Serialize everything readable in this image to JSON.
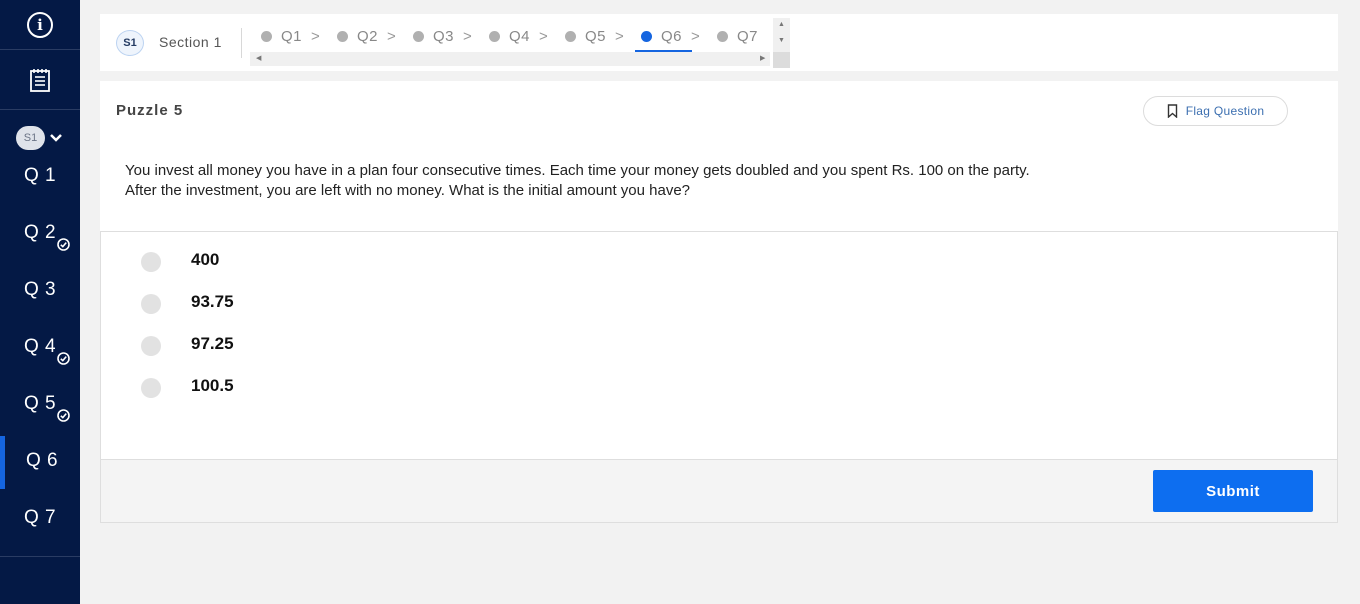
{
  "sidebar": {
    "section_badge": "S1",
    "questions": [
      {
        "label": "Q 1",
        "answered": false,
        "active": false
      },
      {
        "label": "Q 2",
        "answered": true,
        "active": false
      },
      {
        "label": "Q 3",
        "answered": false,
        "active": false
      },
      {
        "label": "Q 4",
        "answered": true,
        "active": false
      },
      {
        "label": "Q 5",
        "answered": true,
        "active": false
      },
      {
        "label": "Q 6",
        "answered": false,
        "active": true
      },
      {
        "label": "Q 7",
        "answered": false,
        "active": false
      }
    ]
  },
  "topnav": {
    "section_badge": "S1",
    "section_label": "Section 1",
    "tabs": [
      "Q1",
      "Q2",
      "Q3",
      "Q4",
      "Q5",
      "Q6",
      "Q7"
    ],
    "active_tab": "Q6"
  },
  "question": {
    "title": "Puzzle 5",
    "flag_label": "Flag Question",
    "text_line1": "You invest all money you have in a plan four consecutive times. Each time your money gets doubled and you spent Rs. 100 on the party.",
    "text_line2": "After the investment, you are left with no money. What is the initial amount you have?"
  },
  "options": [
    "400",
    "93.75",
    "97.25",
    "100.5"
  ],
  "footer": {
    "submit_label": "Submit"
  },
  "colors": {
    "sidebar_bg": "#041945",
    "accent": "#1565e0",
    "submit_bg": "#0d6ef0"
  }
}
